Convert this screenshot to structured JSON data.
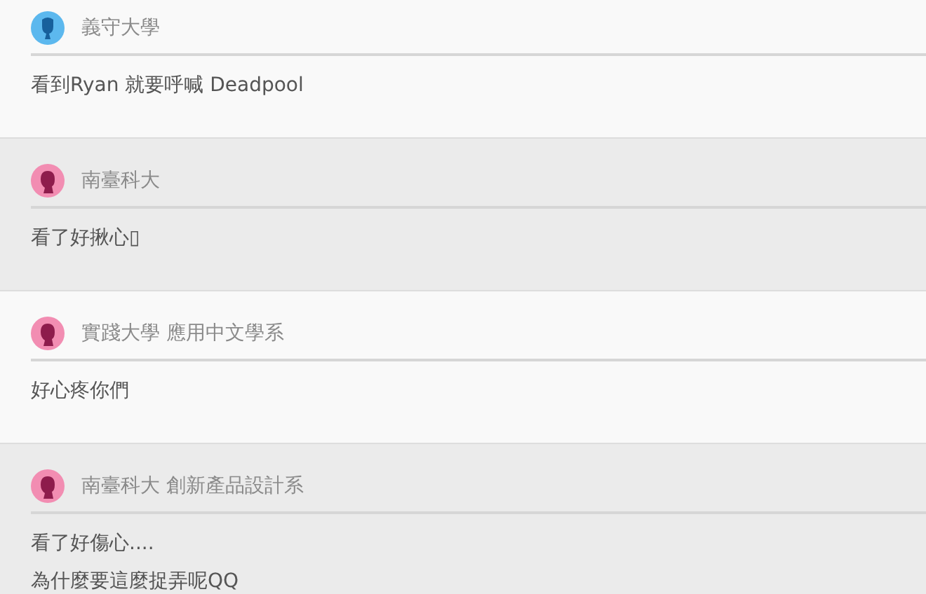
{
  "comments": [
    {
      "author": "義守大學",
      "kind": "male",
      "lines": [
        "看到Ryan 就要呼喊 Deadpool"
      ]
    },
    {
      "author": "南臺科大",
      "kind": "female",
      "lines": [
        "看了好揪心▯"
      ]
    },
    {
      "author": "實踐大學 應用中文學系",
      "kind": "female",
      "lines": [
        "好心疼你們"
      ]
    },
    {
      "author": "南臺科大 創新產品設計系",
      "kind": "female",
      "lines": [
        "看了好傷心....",
        "為什麼要這麼捉弄呢QQ"
      ]
    }
  ]
}
